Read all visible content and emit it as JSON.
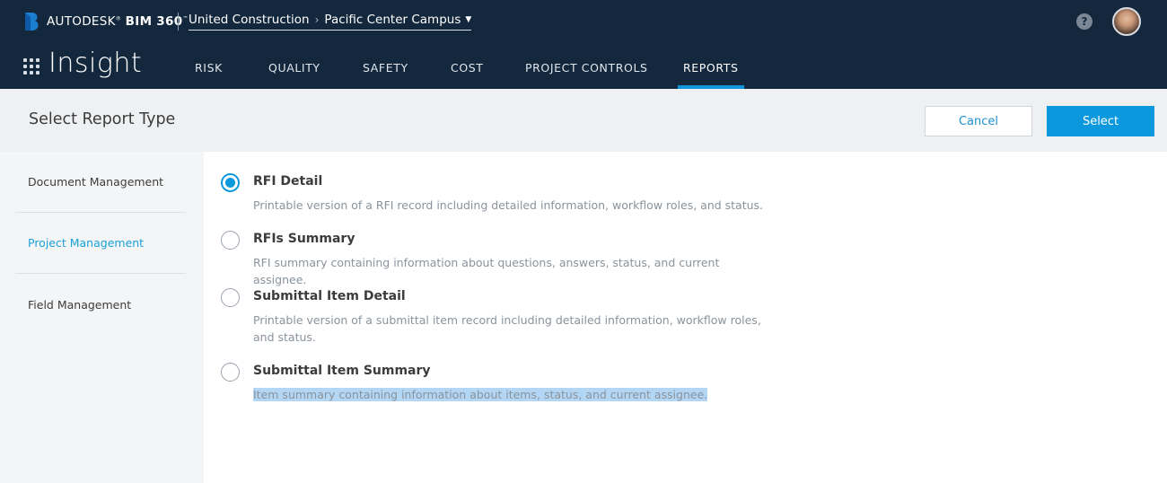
{
  "header": {
    "brand_prefix": "AUTODESK",
    "brand_suffix": "BIM 360",
    "breadcrumb": [
      "United Construction",
      "Pacific Center Campus"
    ],
    "help_label": "?",
    "app_title": "Insight",
    "nav": [
      "RISK",
      "QUALITY",
      "SAFETY",
      "COST",
      "PROJECT CONTROLS",
      "REPORTS"
    ],
    "active_nav": "REPORTS"
  },
  "subheader": {
    "title": "Select Report Type",
    "cancel_label": "Cancel",
    "select_label": "Select"
  },
  "sidebar": {
    "items": [
      "Document Management",
      "Project Management",
      "Field Management"
    ],
    "active_item": "Project Management"
  },
  "reports": [
    {
      "name": "RFI Detail",
      "description": "Printable version of a RFI record including detailed information, workflow roles, and status.",
      "selected": true
    },
    {
      "name": "RFIs Summary",
      "description": "RFI summary containing information about questions, answers, status, and current assignee.",
      "selected": false
    },
    {
      "name": "Submittal Item Detail",
      "description": "Printable version of a submittal item record including detailed information, workflow roles, and status.",
      "selected": false
    },
    {
      "name": "Submittal Item Summary",
      "description": "Item summary containing information about items, status, and current assignee.",
      "selected": false
    }
  ],
  "colors": {
    "header_bg": "#13273d",
    "accent": "#0c98dd",
    "active_link": "#1aa1d8",
    "text_highlight": "#b3d6f4"
  }
}
